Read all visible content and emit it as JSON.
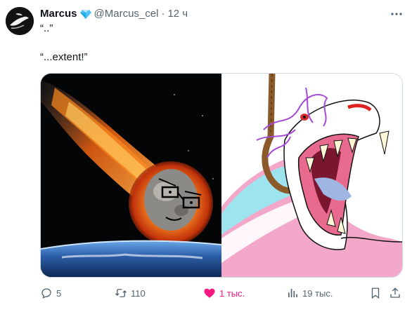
{
  "author": {
    "name": "Marcus",
    "handle": "@Marcus_cel",
    "separator": "·",
    "time": "12 ч",
    "verified_icon": "gem-icon",
    "avatar_icon": "avatar-image"
  },
  "tweet": {
    "line1": "“..”",
    "line2": "“...extent!”"
  },
  "media": {
    "left_image": "meteor-wojak-image",
    "right_image": "screaming-dinosaur-image"
  },
  "actions": {
    "replies": "5",
    "retweets": "110",
    "likes": "1 тыс.",
    "views": "19 тыс."
  },
  "colors": {
    "text": "#0f1419",
    "secondary": "#536471",
    "like": "#f91880",
    "border": "#cfd9de"
  }
}
